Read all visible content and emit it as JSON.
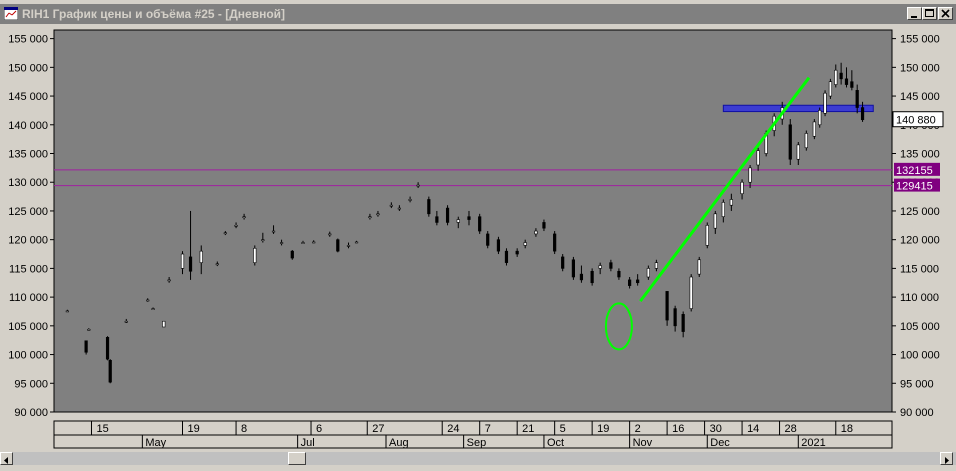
{
  "window": {
    "title": "RIH1 График цены и объёма #25 - [Дневной]"
  },
  "chart_data": {
    "type": "candlestick",
    "ylim": [
      90000,
      156500
    ],
    "y_ticks": [
      90000,
      95000,
      100000,
      105000,
      110000,
      115000,
      120000,
      125000,
      130000,
      135000,
      140000,
      145000,
      150000,
      155000
    ],
    "y_tick_labels": [
      "90 000",
      "95 000",
      "100 000",
      "105 000",
      "110 000",
      "115 000",
      "120 000",
      "125 000",
      "130 000",
      "135 000",
      "140 000",
      "145 000",
      "150 000",
      "155 000"
    ],
    "date_row": [
      {
        "d": "2020-04-15",
        "t": "15"
      },
      {
        "d": "2020-05-19",
        "t": "19"
      },
      {
        "d": "2020-06-08",
        "t": "8"
      },
      {
        "d": "2020-07-06",
        "t": "6"
      },
      {
        "d": "2020-07-27",
        "t": "27"
      },
      {
        "d": "2020-08-24",
        "t": "24"
      },
      {
        "d": "2020-09-07",
        "t": "7"
      },
      {
        "d": "2020-09-21",
        "t": "21"
      },
      {
        "d": "2020-10-05",
        "t": "5"
      },
      {
        "d": "2020-10-19",
        "t": "19"
      },
      {
        "d": "2020-11-02",
        "t": "2"
      },
      {
        "d": "2020-11-16",
        "t": "16"
      },
      {
        "d": "2020-11-30",
        "t": "30"
      },
      {
        "d": "2020-12-14",
        "t": "14"
      },
      {
        "d": "2020-12-28",
        "t": "28"
      },
      {
        "d": "2021-01-18",
        "t": "18"
      }
    ],
    "month_row": [
      {
        "d": "2020-05-04",
        "t": "May"
      },
      {
        "d": "2020-07-01",
        "t": "Jul"
      },
      {
        "d": "2020-08-03",
        "t": "Aug"
      },
      {
        "d": "2020-09-01",
        "t": "Sep"
      },
      {
        "d": "2020-10-01",
        "t": "Oct"
      },
      {
        "d": "2020-11-02",
        "t": "Nov"
      },
      {
        "d": "2020-12-01",
        "t": "Dec"
      },
      {
        "d": "2021-01-04",
        "t": "2021"
      }
    ],
    "last_price": 140880,
    "last_price_label": "140 880",
    "h_lines": [
      {
        "value": 132155,
        "label": "132155",
        "color": "#a020a0"
      },
      {
        "value": 129415,
        "label": "129415",
        "color": "#a020a0"
      }
    ],
    "zone": {
      "from_date": "2020-12-07",
      "to_date": "2021-02-01",
      "low": 142300,
      "high": 143400,
      "color": "#3030e0"
    },
    "trendline": {
      "from_date": "2020-11-06",
      "from_value": 109300,
      "to_date": "2021-01-08",
      "to_value": 148200,
      "color": "#00ff00"
    },
    "ellipse": {
      "date": "2020-10-29",
      "value": 104900,
      "color": "#00ff00"
    },
    "candles": [
      {
        "d": "2020-04-06",
        "o": 107600,
        "h": 107800,
        "l": 107400,
        "c": 107600
      },
      {
        "d": "2020-04-13",
        "o": 102400,
        "h": 102400,
        "l": 100000,
        "c": 100400
      },
      {
        "d": "2020-04-14",
        "o": 104400,
        "h": 104600,
        "l": 104200,
        "c": 104400
      },
      {
        "d": "2020-04-21",
        "o": 103000,
        "h": 103200,
        "l": 99000,
        "c": 99200
      },
      {
        "d": "2020-04-22",
        "o": 99000,
        "h": 99200,
        "l": 95000,
        "c": 95200
      },
      {
        "d": "2020-04-28",
        "o": 105800,
        "h": 106200,
        "l": 105500,
        "c": 105800
      },
      {
        "d": "2020-05-06",
        "o": 109500,
        "h": 109800,
        "l": 109200,
        "c": 109500
      },
      {
        "d": "2020-05-08",
        "o": 108000,
        "h": 108200,
        "l": 107800,
        "c": 108000
      },
      {
        "d": "2020-05-12",
        "o": 104800,
        "h": 105800,
        "l": 104800,
        "c": 105800
      },
      {
        "d": "2020-05-14",
        "o": 113000,
        "h": 113500,
        "l": 112500,
        "c": 113000
      },
      {
        "d": "2020-05-19",
        "o": 115000,
        "h": 118000,
        "l": 114000,
        "c": 117500
      },
      {
        "d": "2020-05-22",
        "o": 117000,
        "h": 125000,
        "l": 113000,
        "c": 114500
      },
      {
        "d": "2020-05-26",
        "o": 116000,
        "h": 119000,
        "l": 114000,
        "c": 118000
      },
      {
        "d": "2020-06-01",
        "o": 115800,
        "h": 116200,
        "l": 115400,
        "c": 115800
      },
      {
        "d": "2020-06-04",
        "o": 121200,
        "h": 121500,
        "l": 120800,
        "c": 121200
      },
      {
        "d": "2020-06-08",
        "o": 122500,
        "h": 123000,
        "l": 122000,
        "c": 122500
      },
      {
        "d": "2020-06-11",
        "o": 124000,
        "h": 124500,
        "l": 123500,
        "c": 124000
      },
      {
        "d": "2020-06-15",
        "o": 116000,
        "h": 119000,
        "l": 115500,
        "c": 118500
      },
      {
        "d": "2020-06-18",
        "o": 120000,
        "h": 121200,
        "l": 119500,
        "c": 120000
      },
      {
        "d": "2020-06-22",
        "o": 121500,
        "h": 122500,
        "l": 121000,
        "c": 121500
      },
      {
        "d": "2020-06-25",
        "o": 119500,
        "h": 120000,
        "l": 119000,
        "c": 119500
      },
      {
        "d": "2020-06-29",
        "o": 118000,
        "h": 118200,
        "l": 116500,
        "c": 116800
      },
      {
        "d": "2020-07-03",
        "o": 119500,
        "h": 119800,
        "l": 119300,
        "c": 119500
      },
      {
        "d": "2020-07-07",
        "o": 119600,
        "h": 119900,
        "l": 119400,
        "c": 119600
      },
      {
        "d": "2020-07-13",
        "o": 121000,
        "h": 121400,
        "l": 120500,
        "c": 121000
      },
      {
        "d": "2020-07-16",
        "o": 120000,
        "h": 120200,
        "l": 117800,
        "c": 118000
      },
      {
        "d": "2020-07-20",
        "o": 119000,
        "h": 119500,
        "l": 118500,
        "c": 119000
      },
      {
        "d": "2020-07-23",
        "o": 119600,
        "h": 119800,
        "l": 119400,
        "c": 119600
      },
      {
        "d": "2020-07-28",
        "o": 124000,
        "h": 124500,
        "l": 123500,
        "c": 124000
      },
      {
        "d": "2020-07-31",
        "o": 124500,
        "h": 125000,
        "l": 124000,
        "c": 124500
      },
      {
        "d": "2020-08-05",
        "o": 126000,
        "h": 126500,
        "l": 125500,
        "c": 126000
      },
      {
        "d": "2020-08-08",
        "o": 125500,
        "h": 126000,
        "l": 125000,
        "c": 125500
      },
      {
        "d": "2020-08-12",
        "o": 127000,
        "h": 127500,
        "l": 126500,
        "c": 127000
      },
      {
        "d": "2020-08-15",
        "o": 129500,
        "h": 130000,
        "l": 129000,
        "c": 129500
      },
      {
        "d": "2020-08-19",
        "o": 127000,
        "h": 127500,
        "l": 124000,
        "c": 124500
      },
      {
        "d": "2020-08-22",
        "o": 124000,
        "h": 125000,
        "l": 122500,
        "c": 123000
      },
      {
        "d": "2020-08-26",
        "o": 125500,
        "h": 126000,
        "l": 122500,
        "c": 123000
      },
      {
        "d": "2020-08-30",
        "o": 123000,
        "h": 124000,
        "l": 122000,
        "c": 123500
      },
      {
        "d": "2020-09-03",
        "o": 124000,
        "h": 125000,
        "l": 122500,
        "c": 123500
      },
      {
        "d": "2020-09-07",
        "o": 124000,
        "h": 124500,
        "l": 121000,
        "c": 121500
      },
      {
        "d": "2020-09-10",
        "o": 121000,
        "h": 121500,
        "l": 118500,
        "c": 119000
      },
      {
        "d": "2020-09-14",
        "o": 120000,
        "h": 120500,
        "l": 117500,
        "c": 118000
      },
      {
        "d": "2020-09-17",
        "o": 118000,
        "h": 118500,
        "l": 115500,
        "c": 116000
      },
      {
        "d": "2020-09-21",
        "o": 118000,
        "h": 118500,
        "l": 117000,
        "c": 117500
      },
      {
        "d": "2020-09-24",
        "o": 119000,
        "h": 120000,
        "l": 118500,
        "c": 119500
      },
      {
        "d": "2020-09-28",
        "o": 121000,
        "h": 122000,
        "l": 120500,
        "c": 121500
      },
      {
        "d": "2020-10-01",
        "o": 123000,
        "h": 123500,
        "l": 121500,
        "c": 122000
      },
      {
        "d": "2020-10-05",
        "o": 121000,
        "h": 121500,
        "l": 117500,
        "c": 118000
      },
      {
        "d": "2020-10-08",
        "o": 117000,
        "h": 117500,
        "l": 114500,
        "c": 115000
      },
      {
        "d": "2020-10-12",
        "o": 116500,
        "h": 117000,
        "l": 113000,
        "c": 113500
      },
      {
        "d": "2020-10-15",
        "o": 114000,
        "h": 115500,
        "l": 112500,
        "c": 113000
      },
      {
        "d": "2020-10-19",
        "o": 114500,
        "h": 115000,
        "l": 112000,
        "c": 112500
      },
      {
        "d": "2020-10-22",
        "o": 115000,
        "h": 116000,
        "l": 114000,
        "c": 115500
      },
      {
        "d": "2020-10-26",
        "o": 116000,
        "h": 116500,
        "l": 114500,
        "c": 115000
      },
      {
        "d": "2020-10-29",
        "o": 114500,
        "h": 115000,
        "l": 113000,
        "c": 113500
      },
      {
        "d": "2020-11-02",
        "o": 113000,
        "h": 113500,
        "l": 111500,
        "c": 112000
      },
      {
        "d": "2020-11-05",
        "o": 113000,
        "h": 114000,
        "l": 112000,
        "c": 112500
      },
      {
        "d": "2020-11-09",
        "o": 113500,
        "h": 115500,
        "l": 113000,
        "c": 115000
      },
      {
        "d": "2020-11-12",
        "o": 115000,
        "h": 116500,
        "l": 114500,
        "c": 116000
      },
      {
        "d": "2020-11-16",
        "o": 111000,
        "h": 109000,
        "l": 105000,
        "c": 106000
      },
      {
        "d": "2020-11-19",
        "o": 108000,
        "h": 108500,
        "l": 104000,
        "c": 105000
      },
      {
        "d": "2020-11-22",
        "o": 107000,
        "h": 107500,
        "l": 103000,
        "c": 104000
      },
      {
        "d": "2020-11-25",
        "o": 108000,
        "h": 114000,
        "l": 107500,
        "c": 113500
      },
      {
        "d": "2020-11-28",
        "o": 114000,
        "h": 117000,
        "l": 113500,
        "c": 116500
      },
      {
        "d": "2020-12-01",
        "o": 119000,
        "h": 123000,
        "l": 118500,
        "c": 122500
      },
      {
        "d": "2020-12-04",
        "o": 122000,
        "h": 125000,
        "l": 121000,
        "c": 124500
      },
      {
        "d": "2020-12-07",
        "o": 124000,
        "h": 127000,
        "l": 123000,
        "c": 126500
      },
      {
        "d": "2020-12-10",
        "o": 126000,
        "h": 128000,
        "l": 125000,
        "c": 127000
      },
      {
        "d": "2020-12-14",
        "o": 128000,
        "h": 130500,
        "l": 127000,
        "c": 130000
      },
      {
        "d": "2020-12-17",
        "o": 130000,
        "h": 133000,
        "l": 129000,
        "c": 132500
      },
      {
        "d": "2020-12-20",
        "o": 133000,
        "h": 136000,
        "l": 132000,
        "c": 135500
      },
      {
        "d": "2020-12-23",
        "o": 135000,
        "h": 139000,
        "l": 134500,
        "c": 138500
      },
      {
        "d": "2020-12-26",
        "o": 139000,
        "h": 142000,
        "l": 138000,
        "c": 141500
      },
      {
        "d": "2020-12-29",
        "o": 141000,
        "h": 144000,
        "l": 140000,
        "c": 143000
      },
      {
        "d": "2021-01-01",
        "o": 140000,
        "h": 141000,
        "l": 133000,
        "c": 134000
      },
      {
        "d": "2021-01-04",
        "o": 134000,
        "h": 137000,
        "l": 133000,
        "c": 136500
      },
      {
        "d": "2021-01-07",
        "o": 136000,
        "h": 139000,
        "l": 135500,
        "c": 138500
      },
      {
        "d": "2021-01-10",
        "o": 138000,
        "h": 141000,
        "l": 137500,
        "c": 140500
      },
      {
        "d": "2021-01-12",
        "o": 140000,
        "h": 143000,
        "l": 139500,
        "c": 142500
      },
      {
        "d": "2021-01-14",
        "o": 142000,
        "h": 146000,
        "l": 141500,
        "c": 145500
      },
      {
        "d": "2021-01-16",
        "o": 145000,
        "h": 148000,
        "l": 144500,
        "c": 147500
      },
      {
        "d": "2021-01-18",
        "o": 147000,
        "h": 150500,
        "l": 146500,
        "c": 149500
      },
      {
        "d": "2021-01-20",
        "o": 149000,
        "h": 150800,
        "l": 147000,
        "c": 148000
      },
      {
        "d": "2021-01-22",
        "o": 148000,
        "h": 150000,
        "l": 146500,
        "c": 147000
      },
      {
        "d": "2021-01-24",
        "o": 147500,
        "h": 149500,
        "l": 146000,
        "c": 146500
      },
      {
        "d": "2021-01-26",
        "o": 146000,
        "h": 147000,
        "l": 142000,
        "c": 143000
      },
      {
        "d": "2021-01-28",
        "o": 143000,
        "h": 144000,
        "l": 140500,
        "c": 140880
      }
    ]
  }
}
